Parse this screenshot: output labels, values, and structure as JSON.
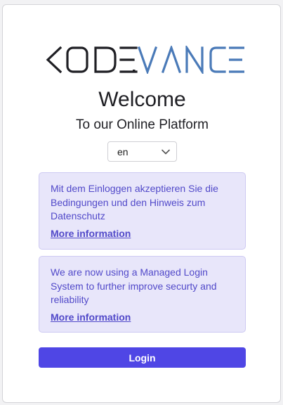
{
  "brand": {
    "logo_text": "KODE.VANCE",
    "logo_dark_color": "#1f1f24",
    "logo_accent_color": "#4a7ab8"
  },
  "welcome": {
    "title": "Welcome",
    "subtitle": "To our Online Platform"
  },
  "language": {
    "selected": "en",
    "icon": "chevron-down-icon"
  },
  "notices": [
    {
      "text": "Mit dem Einloggen akzeptieren Sie die Bedingungen und den Hinweis zum Datenschutz",
      "link_label": "More information"
    },
    {
      "text": "We are now using a Managed Login System to further improve securty and reliability",
      "link_label": "More information"
    }
  ],
  "login": {
    "label": "Login",
    "color": "#4f46e5"
  },
  "colors": {
    "notice_background": "#e8e6fa",
    "notice_text": "#5149c9"
  }
}
